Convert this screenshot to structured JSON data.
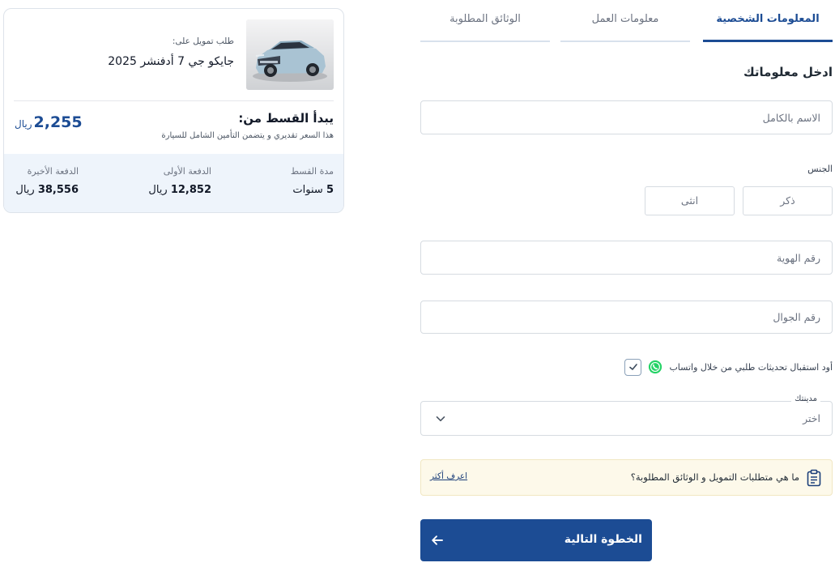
{
  "tabs": [
    {
      "label": "المعلومات الشخصية",
      "active": true
    },
    {
      "label": "معلومات العمل",
      "active": false
    },
    {
      "label": "الوثائق المطلوبة",
      "active": false
    }
  ],
  "form": {
    "section_title": "ادخل معلوماتك",
    "full_name_placeholder": "الاسم بالكامل",
    "gender_label": "الجنس",
    "gender_male": "ذكر",
    "gender_female": "انثى",
    "id_placeholder": "رقم الهوية",
    "mobile_placeholder": "رقم الجوال",
    "whatsapp_text": "أود استقبال تحديثات طلبي من خلال واتساب",
    "whatsapp_checked": true,
    "city_label": "مدينتك",
    "city_value": "اختر",
    "info_text": "ما هي متطلبات التمويل و الوثائق المطلوبة؟",
    "info_link": "اعرف أكثر",
    "next_button": "الخطوة التالية"
  },
  "summary": {
    "financing_label": "طلب تمويل على:",
    "car_name": "جايكو جي 7 أدفنشر 2025",
    "starts_from_label": "يبدأ القسط من:",
    "price_value": "2,255",
    "price_currency": "ريال",
    "price_note": "هذا السعر تقديري و يتضمن التأمين الشامل للسيارة",
    "terms": [
      {
        "label": "مدة القسط",
        "value": "5",
        "unit": "سنوات"
      },
      {
        "label": "الدفعة الأولى",
        "value": "12,852",
        "unit": "ريال"
      },
      {
        "label": "الدفعة الأخيرة",
        "value": "38,556",
        "unit": "ريال"
      }
    ]
  },
  "colors": {
    "primary": "#1c4c94",
    "info_bg": "#fdf9ea",
    "terms_bg": "#eef4fb",
    "whatsapp": "#25d366"
  },
  "icons": {
    "whatsapp": "whatsapp-icon",
    "chevron": "chevron-down-icon",
    "clipboard": "clipboard-icon",
    "arrow": "arrow-left-icon",
    "check": "check-icon"
  }
}
